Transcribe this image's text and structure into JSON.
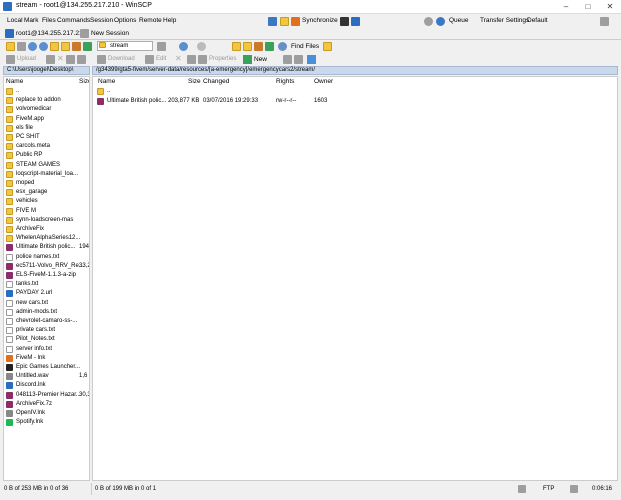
{
  "window": {
    "title": "stream - root1@134.255.217.210 - WinSCP"
  },
  "menubar": {
    "items": [
      "Local",
      "Mark",
      "Files",
      "Commands",
      "Session",
      "Options",
      "Remote",
      "Help"
    ],
    "synchronize_label": "Synchronize",
    "queue_label": "Queue",
    "transfer_settings_label": "Transfer Settings",
    "transfer_settings_value": "Default"
  },
  "session_tabs": {
    "active": "root1@134.255.217.210",
    "new_session": "New Session"
  },
  "local": {
    "path": "C:\\Users\\joogel\\Desktop\\",
    "upload_label": "Upload",
    "columns": [
      "Name",
      "Size"
    ],
    "rows": [
      {
        "name": "..",
        "size": "",
        "icon": "up"
      },
      {
        "name": "replace to addon",
        "size": "",
        "icon": "folder"
      },
      {
        "name": "volvomedicar",
        "size": "",
        "icon": "folder"
      },
      {
        "name": "FiveM.app",
        "size": "",
        "icon": "folder"
      },
      {
        "name": "els file",
        "size": "",
        "icon": "folder"
      },
      {
        "name": "PC SHIT",
        "size": "",
        "icon": "folder"
      },
      {
        "name": "carcols.meta",
        "size": "",
        "icon": "folder"
      },
      {
        "name": "Public RP",
        "size": "",
        "icon": "folder"
      },
      {
        "name": "STEAM GAMES",
        "size": "",
        "icon": "folder"
      },
      {
        "name": "loqscript-material_loa...",
        "size": "",
        "icon": "folder"
      },
      {
        "name": "moped",
        "size": "",
        "icon": "folder"
      },
      {
        "name": "esx_garage",
        "size": "",
        "icon": "folder"
      },
      {
        "name": "vehicles",
        "size": "",
        "icon": "folder"
      },
      {
        "name": "FIVE M",
        "size": "",
        "icon": "folder"
      },
      {
        "name": "synn-loadscreen-mas",
        "size": "",
        "icon": "folder"
      },
      {
        "name": "ArchiveFix",
        "size": "",
        "icon": "folder"
      },
      {
        "name": "WhelenAlphaSeries12...",
        "size": "",
        "icon": "folder"
      },
      {
        "name": "Ultimate British polic...",
        "size": "194,4",
        "icon": "archive"
      },
      {
        "name": "police names.txt",
        "size": "",
        "icon": "txt"
      },
      {
        "name": "ec5711-Volvo_RRV_Re...",
        "size": "33,2",
        "icon": "archive"
      },
      {
        "name": "ELS-FiveM-1.1.3-a-zip",
        "size": "",
        "icon": "archive"
      },
      {
        "name": "tanks.txt",
        "size": "",
        "icon": "txt"
      },
      {
        "name": "PAYDAY 2.url",
        "size": "",
        "icon": "blue"
      },
      {
        "name": "new cars.txt",
        "size": "",
        "icon": "txt"
      },
      {
        "name": "admin-mods.txt",
        "size": "",
        "icon": "txt"
      },
      {
        "name": "chevrolet-camaro-ss-...",
        "size": "",
        "icon": "txt"
      },
      {
        "name": "private cars.txt",
        "size": "",
        "icon": "txt"
      },
      {
        "name": "Pilot_Notes.txt",
        "size": "",
        "icon": "txt"
      },
      {
        "name": "server info.txt",
        "size": "",
        "icon": "txt"
      },
      {
        "name": "FiveM - lnk",
        "size": "",
        "icon": "orange"
      },
      {
        "name": "Epic Games Launcher...",
        "size": "",
        "icon": "dark"
      },
      {
        "name": "Untitled.wav",
        "size": "1,6",
        "icon": "gray"
      },
      {
        "name": "Discord.lnk",
        "size": "",
        "icon": "blue"
      },
      {
        "name": "048113-Premier Hazar...",
        "size": "30,3",
        "icon": "archive"
      },
      {
        "name": "ArchiveFix.7z",
        "size": "",
        "icon": "archive"
      },
      {
        "name": "OpenIV.lnk",
        "size": "",
        "icon": "gray"
      },
      {
        "name": "Spotify.lnk",
        "size": "",
        "icon": "green"
      }
    ],
    "status": "0 B of 253 MB in 0 of 36"
  },
  "remote": {
    "combo_value": "stream",
    "path": "/g34399/gta5-fivem/server-data/resources/[a-emergency]/emergencycars2/stream/",
    "find_files_label": "Find Files",
    "download_label": "Download",
    "edit_label": "Edit",
    "properties_label": "Properties",
    "new_label": "New",
    "columns": [
      "Name",
      "Size",
      "Changed",
      "Rights",
      "Owner"
    ],
    "rows": [
      {
        "name": "..",
        "size": "",
        "changed": "",
        "rights": "",
        "owner": ""
      },
      {
        "name": "Ultimate British polic...",
        "size": "203,877 KB",
        "changed": "03/07/2016 19:29:33",
        "rights": "rw-r--r--",
        "owner": "1603"
      }
    ],
    "status": "0 B of 199 MB in 0 of 1"
  },
  "status_right": {
    "protocol": "FTP",
    "time": "0:06:16"
  },
  "colors": {
    "accent": "#2e6fbd",
    "path_bar": "#c9d8ea",
    "folder": "#f2c640"
  }
}
